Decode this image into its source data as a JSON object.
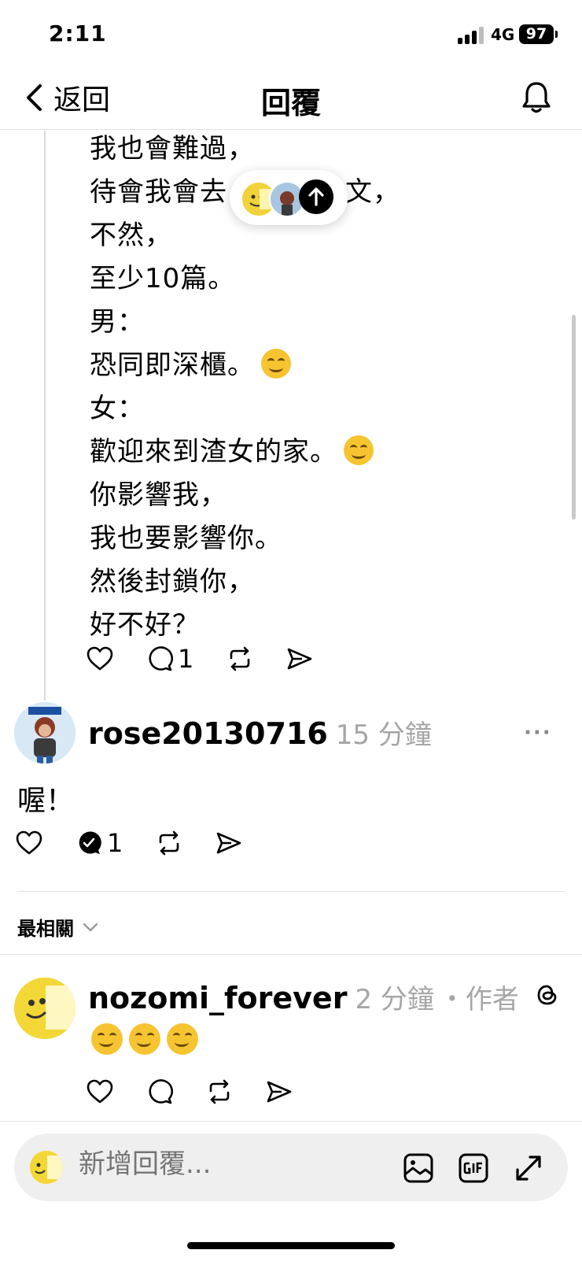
{
  "status_bar": {
    "time": "2:11",
    "network": "4G",
    "battery": "97"
  },
  "nav": {
    "back_label": "返回",
    "title": "回覆"
  },
  "thread_post": {
    "lines": [
      "我也會難過，",
      "待會我會去",
      "不然，",
      "至少10篇。",
      "男：",
      "恐同即深櫃。",
      "女：",
      "歡迎來到渣女的家。",
      "你影響我，",
      "我也要影響你。",
      "然後封鎖你，",
      "好不好？"
    ],
    "line2_tail": "貼文，",
    "reply_count": "1"
  },
  "comment": {
    "username": "rose20130716",
    "time": "15 分鐘",
    "more": "···",
    "text": "喔！",
    "reply_count": "1"
  },
  "sort": {
    "label": "最相關"
  },
  "reply": {
    "username": "nozomi_forever",
    "time": "2 分鐘",
    "tag": "・作者"
  },
  "composer": {
    "placeholder": "新增回覆..."
  },
  "icons": [
    "chevron-left-icon",
    "bell-icon",
    "heart-icon",
    "comment-icon",
    "repost-icon",
    "share-icon",
    "image-icon",
    "gif-icon",
    "expand-icon",
    "threads-icon"
  ]
}
